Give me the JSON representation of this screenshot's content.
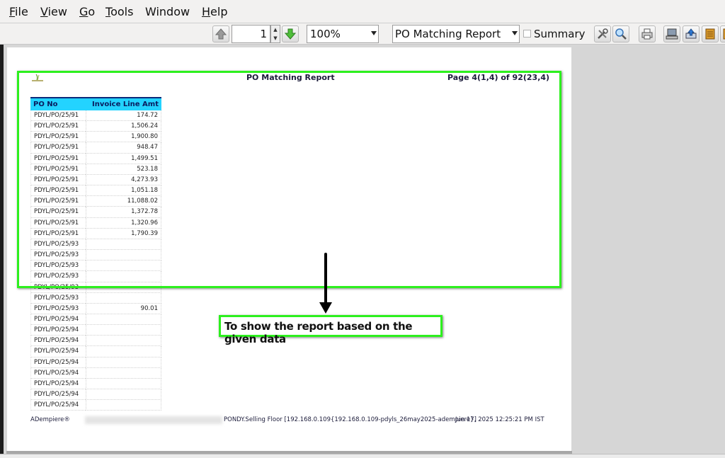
{
  "menu": [
    {
      "label": "File",
      "mnemonic": "F",
      "rest": "ile"
    },
    {
      "label": "View",
      "mnemonic": "V",
      "rest": "iew"
    },
    {
      "label": "Go",
      "mnemonic": "G",
      "rest": "o"
    },
    {
      "label": "Tools",
      "mnemonic": "T",
      "rest": "ools"
    },
    {
      "label": "Window",
      "mnemonic": "",
      "rest": "Window"
    },
    {
      "label": "Help",
      "mnemonic": "H",
      "rest": "elp"
    }
  ],
  "toolbar": {
    "page_number": "1",
    "zoom": "100%",
    "report_select": "PO Matching Report",
    "summary_label": "Summary",
    "summary_checked": false
  },
  "report": {
    "title": "PO Matching Report",
    "page_info": "Page 4(1,4) of 92(23,4)",
    "columns": [
      "PO No",
      "Invoice Line Amt"
    ],
    "rows": [
      [
        "PDYL/PO/25/91",
        "174.72"
      ],
      [
        "PDYL/PO/25/91",
        "1,506.24"
      ],
      [
        "PDYL/PO/25/91",
        "1,900.80"
      ],
      [
        "PDYL/PO/25/91",
        "948.47"
      ],
      [
        "PDYL/PO/25/91",
        "1,499.51"
      ],
      [
        "PDYL/PO/25/91",
        "523.18"
      ],
      [
        "PDYL/PO/25/91",
        "4,273.93"
      ],
      [
        "PDYL/PO/25/91",
        "1,051.18"
      ],
      [
        "PDYL/PO/25/91",
        "11,088.02"
      ],
      [
        "PDYL/PO/25/91",
        "1,372.78"
      ],
      [
        "PDYL/PO/25/91",
        "1,320.96"
      ],
      [
        "PDYL/PO/25/91",
        "1,790.39"
      ],
      [
        "PDYL/PO/25/93",
        ""
      ],
      [
        "PDYL/PO/25/93",
        ""
      ],
      [
        "PDYL/PO/25/93",
        ""
      ],
      [
        "PDYL/PO/25/93",
        ""
      ],
      [
        "PDYL/PO/25/93",
        ""
      ],
      [
        "PDYL/PO/25/93",
        ""
      ],
      [
        "PDYL/PO/25/93",
        "90.01"
      ],
      [
        "PDYL/PO/25/94",
        ""
      ],
      [
        "PDYL/PO/25/94",
        ""
      ],
      [
        "PDYL/PO/25/94",
        ""
      ],
      [
        "PDYL/PO/25/94",
        ""
      ],
      [
        "PDYL/PO/25/94",
        ""
      ],
      [
        "PDYL/PO/25/94",
        ""
      ],
      [
        "PDYL/PO/25/94",
        ""
      ],
      [
        "PDYL/PO/25/94",
        ""
      ],
      [
        "PDYL/PO/25/94",
        ""
      ]
    ],
    "footer_left": "ADempiere®",
    "footer_middle": "PONDY.Selling Floor [192.168.0.109{192.168.0.109-pdyls_26may2025-adempiere}]",
    "footer_right": "Jun 17, 2025 12:25:21 PM IST"
  },
  "annotation": {
    "callout_text": "To show the report based on the given data"
  },
  "colors": {
    "header_bg": "#23d3ff",
    "highlight": "#2df01e"
  }
}
